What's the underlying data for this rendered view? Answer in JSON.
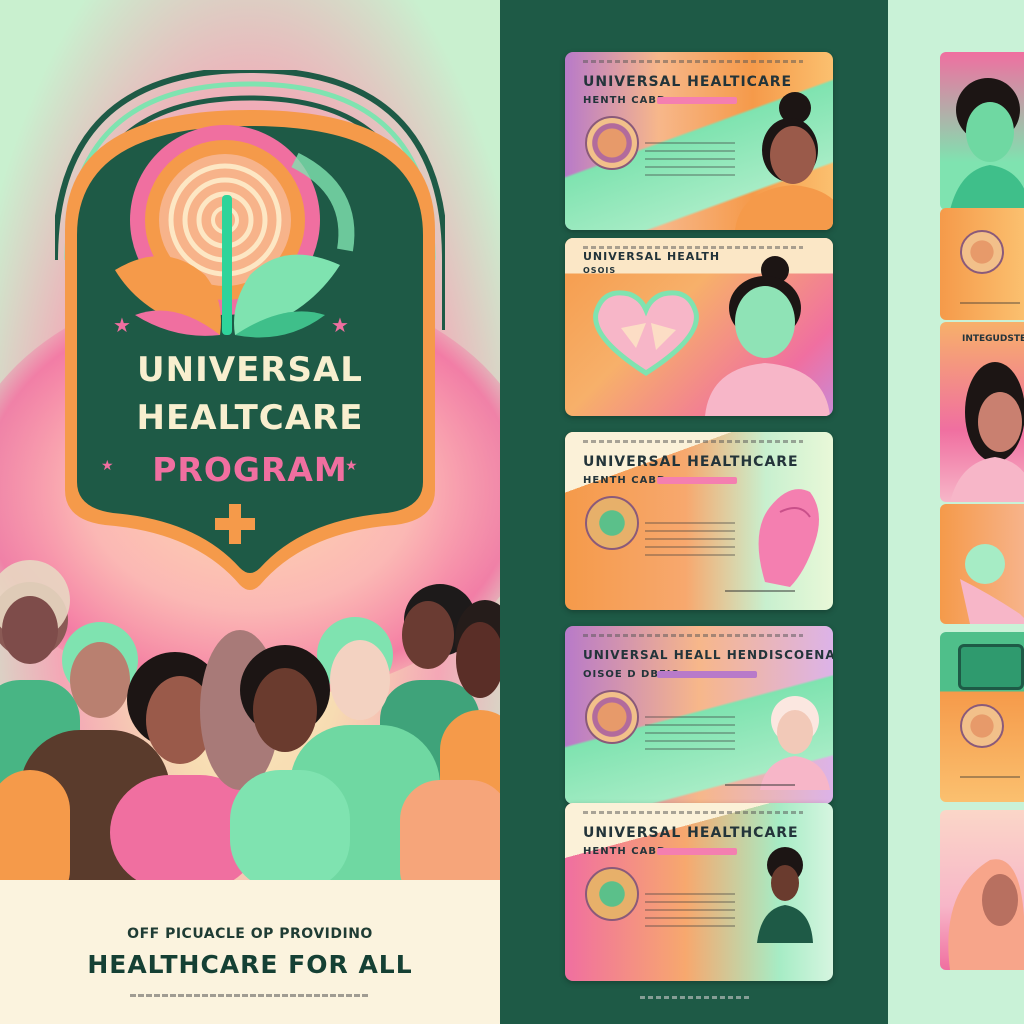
{
  "poster": {
    "title_line1": "UNIVERSAL",
    "title_line2": "HEALTCARE",
    "title_line3": "PROGRAM",
    "subtitle_small": "OFF PICUACLE OP PROVIDINO",
    "subtitle_large": "HEALTHCARE FOR ALL"
  },
  "cards": [
    {
      "heading": "UNIVERSAL HEALTICARE",
      "subheading": "HENTH CABD"
    },
    {
      "heading": "UNIVERSAL HEALTH",
      "subheading": "OSOIS"
    },
    {
      "heading": "UNIVERSAL HEALTHCARE",
      "subheading": "HENTH CABD"
    },
    {
      "heading": "UNIVERSAL HEALL HENDISCOENAL",
      "subheading": "OISOE D DBEIS"
    },
    {
      "heading": "UNIVERSAL HEALTHCARE",
      "subheading": "HENTH CABD"
    }
  ],
  "right_strip": {
    "card_heading": "INTEGUDSTEL AG"
  },
  "colors": {
    "dark_green": "#1e5a46",
    "mint": "#7fe3b0",
    "pink": "#f06fa0",
    "orange": "#f59a4a",
    "cream": "#f8efcf"
  }
}
